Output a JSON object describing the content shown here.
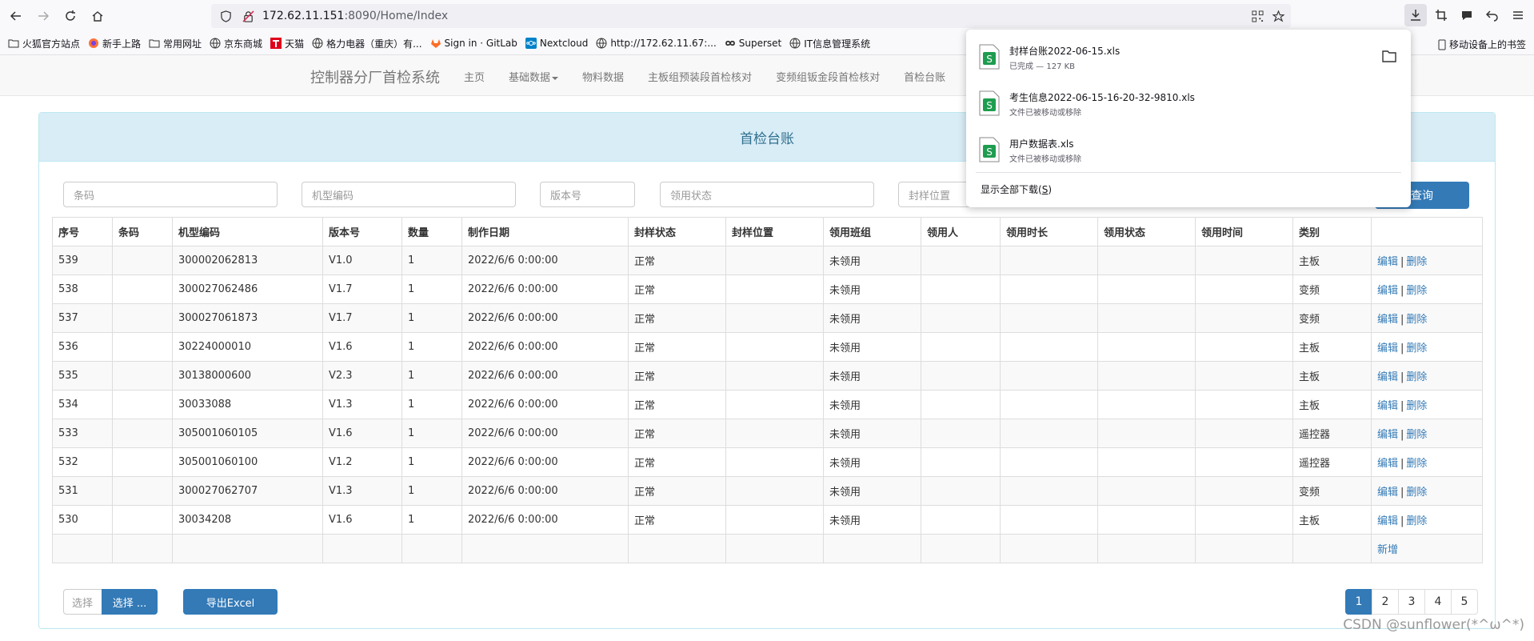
{
  "browser": {
    "url_host": "172.62.11.151",
    "url_path": ":8090/Home/Index",
    "bookmarks": [
      {
        "label": "火狐官方站点",
        "icon": "folder-icon"
      },
      {
        "label": "新手上路",
        "icon": "firefox-icon"
      },
      {
        "label": "常用网址",
        "icon": "folder-icon"
      },
      {
        "label": "京东商城",
        "icon": "globe-icon"
      },
      {
        "label": "天猫",
        "icon": "tmall-icon"
      },
      {
        "label": "格力电器（重庆）有...",
        "icon": "globe-icon"
      },
      {
        "label": "Sign in · GitLab",
        "icon": "gitlab-icon"
      },
      {
        "label": "Nextcloud",
        "icon": "nextcloud-icon"
      },
      {
        "label": "http://172.62.11.67:...",
        "icon": "globe-icon"
      },
      {
        "label": "Superset",
        "icon": "superset-icon"
      },
      {
        "label": "IT信息管理系统",
        "icon": "globe-icon"
      }
    ],
    "mobile_bookmarks": "移动设备上的书签"
  },
  "navbar": {
    "brand": "控制器分厂首检系统",
    "items": [
      {
        "label": "主页",
        "dropdown": false
      },
      {
        "label": "基础数据",
        "dropdown": true
      },
      {
        "label": "物料数据",
        "dropdown": false
      },
      {
        "label": "主板组预装段首检核对",
        "dropdown": false
      },
      {
        "label": "变频组钣金段首检核对",
        "dropdown": false
      },
      {
        "label": "首检台账",
        "dropdown": false
      }
    ]
  },
  "panel": {
    "title": "首检台账"
  },
  "filters": {
    "barcode_placeholder": "条码",
    "model_placeholder": "机型编码",
    "version_placeholder": "版本号",
    "status_placeholder": "领用状态",
    "location_placeholder": "封样位置",
    "query_label": "查询"
  },
  "table": {
    "headers": [
      "序号",
      "条码",
      "机型编码",
      "版本号",
      "数量",
      "制作日期",
      "封样状态",
      "封样位置",
      "领用班组",
      "领用人",
      "领用时长",
      "领用状态",
      "领用时间",
      "类别",
      ""
    ],
    "rows": [
      {
        "id": "539",
        "barcode": "",
        "model": "300002062813",
        "version": "V1.0",
        "qty": "1",
        "date": "2022/6/6 0:00:00",
        "seal_status": "正常",
        "location": "",
        "team": "未领用",
        "person": "",
        "duration": "",
        "use_status": "",
        "use_time": "",
        "category": "主板"
      },
      {
        "id": "538",
        "barcode": "",
        "model": "300027062486",
        "version": "V1.7",
        "qty": "1",
        "date": "2022/6/6 0:00:00",
        "seal_status": "正常",
        "location": "",
        "team": "未领用",
        "person": "",
        "duration": "",
        "use_status": "",
        "use_time": "",
        "category": "变频"
      },
      {
        "id": "537",
        "barcode": "",
        "model": "300027061873",
        "version": "V1.7",
        "qty": "1",
        "date": "2022/6/6 0:00:00",
        "seal_status": "正常",
        "location": "",
        "team": "未领用",
        "person": "",
        "duration": "",
        "use_status": "",
        "use_time": "",
        "category": "变频"
      },
      {
        "id": "536",
        "barcode": "",
        "model": "30224000010",
        "version": "V1.6",
        "qty": "1",
        "date": "2022/6/6 0:00:00",
        "seal_status": "正常",
        "location": "",
        "team": "未领用",
        "person": "",
        "duration": "",
        "use_status": "",
        "use_time": "",
        "category": "主板"
      },
      {
        "id": "535",
        "barcode": "",
        "model": "30138000600",
        "version": "V2.3",
        "qty": "1",
        "date": "2022/6/6 0:00:00",
        "seal_status": "正常",
        "location": "",
        "team": "未领用",
        "person": "",
        "duration": "",
        "use_status": "",
        "use_time": "",
        "category": "主板"
      },
      {
        "id": "534",
        "barcode": "",
        "model": "30033088",
        "version": "V1.3",
        "qty": "1",
        "date": "2022/6/6 0:00:00",
        "seal_status": "正常",
        "location": "",
        "team": "未领用",
        "person": "",
        "duration": "",
        "use_status": "",
        "use_time": "",
        "category": "主板"
      },
      {
        "id": "533",
        "barcode": "",
        "model": "305001060105",
        "version": "V1.6",
        "qty": "1",
        "date": "2022/6/6 0:00:00",
        "seal_status": "正常",
        "location": "",
        "team": "未领用",
        "person": "",
        "duration": "",
        "use_status": "",
        "use_time": "",
        "category": "遥控器"
      },
      {
        "id": "532",
        "barcode": "",
        "model": "305001060100",
        "version": "V1.2",
        "qty": "1",
        "date": "2022/6/6 0:00:00",
        "seal_status": "正常",
        "location": "",
        "team": "未领用",
        "person": "",
        "duration": "",
        "use_status": "",
        "use_time": "",
        "category": "遥控器"
      },
      {
        "id": "531",
        "barcode": "",
        "model": "300027062707",
        "version": "V1.3",
        "qty": "1",
        "date": "2022/6/6 0:00:00",
        "seal_status": "正常",
        "location": "",
        "team": "未领用",
        "person": "",
        "duration": "",
        "use_status": "",
        "use_time": "",
        "category": "变频"
      },
      {
        "id": "530",
        "barcode": "",
        "model": "30034208",
        "version": "V1.6",
        "qty": "1",
        "date": "2022/6/6 0:00:00",
        "seal_status": "正常",
        "location": "",
        "team": "未领用",
        "person": "",
        "duration": "",
        "use_status": "",
        "use_time": "",
        "category": "主板"
      }
    ],
    "edit_label": "编辑",
    "delete_label": "删除",
    "separator": "|",
    "add_label": "新增"
  },
  "bottom": {
    "file_placeholder": "选择",
    "file_button": "选择 ...",
    "export_label": "导出Excel",
    "pages": [
      "1",
      "2",
      "3",
      "4",
      "5"
    ],
    "active_page": "1"
  },
  "downloads": {
    "items": [
      {
        "name": "封样台账2022-06-15.xls",
        "status": "已完成 — 127 KB",
        "has_folder": true
      },
      {
        "name": "考生信息2022-06-15-16-20-32-9810.xls",
        "status": "文件已被移动或移除",
        "has_folder": false
      },
      {
        "name": "用户数据表.xls",
        "status": "文件已被移动或移除",
        "has_folder": false
      }
    ],
    "show_all": "显示全部下载(",
    "show_all_key": "S",
    "show_all_end": ")"
  },
  "watermark": "CSDN @sunflower(*^ω^*)",
  "colors": {
    "primary": "#337ab7",
    "panel_heading_bg": "#d9edf7",
    "panel_heading_text": "#31708f"
  }
}
